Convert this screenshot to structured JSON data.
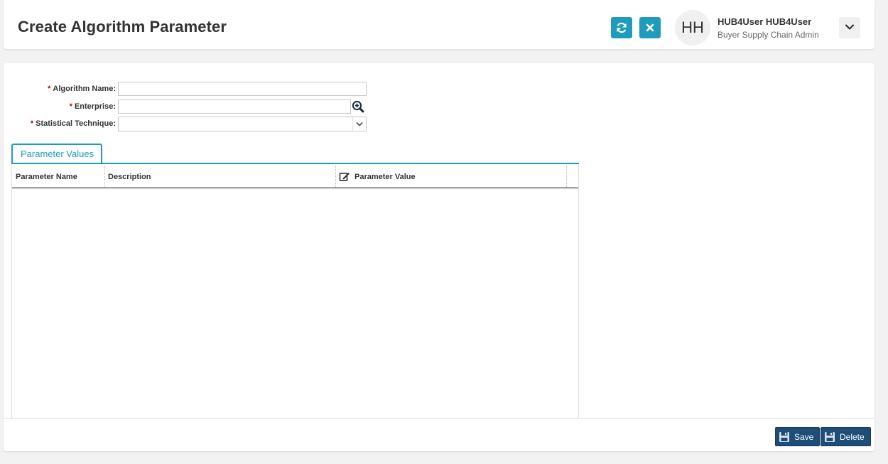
{
  "header": {
    "title": "Create Algorithm Parameter",
    "refresh_icon": "refresh-icon",
    "close_icon": "close-icon",
    "accent_color": "#1f9bbd"
  },
  "user": {
    "initials": "HH",
    "name": "HUB4User HUB4User",
    "role": "Buyer Supply Chain Admin",
    "menu_icon": "chevron-down-icon"
  },
  "form": {
    "required_marker": "*",
    "algorithm_name": {
      "label": "Algorithm Name:",
      "value": ""
    },
    "enterprise": {
      "label": "Enterprise:",
      "value": "",
      "lookup_icon": "search-plus-icon"
    },
    "statistical_technique": {
      "label": "Statistical Technique:",
      "value": ""
    }
  },
  "tabs": [
    {
      "label": "Parameter Values",
      "active": true
    }
  ],
  "grid": {
    "columns": [
      {
        "label": "Parameter Name"
      },
      {
        "label": "Description"
      },
      {
        "label": "Parameter Value",
        "icon": "edit-icon"
      }
    ],
    "rows": []
  },
  "actions": {
    "save_label": "Save",
    "delete_label": "Delete",
    "button_color": "#1e4d78"
  }
}
